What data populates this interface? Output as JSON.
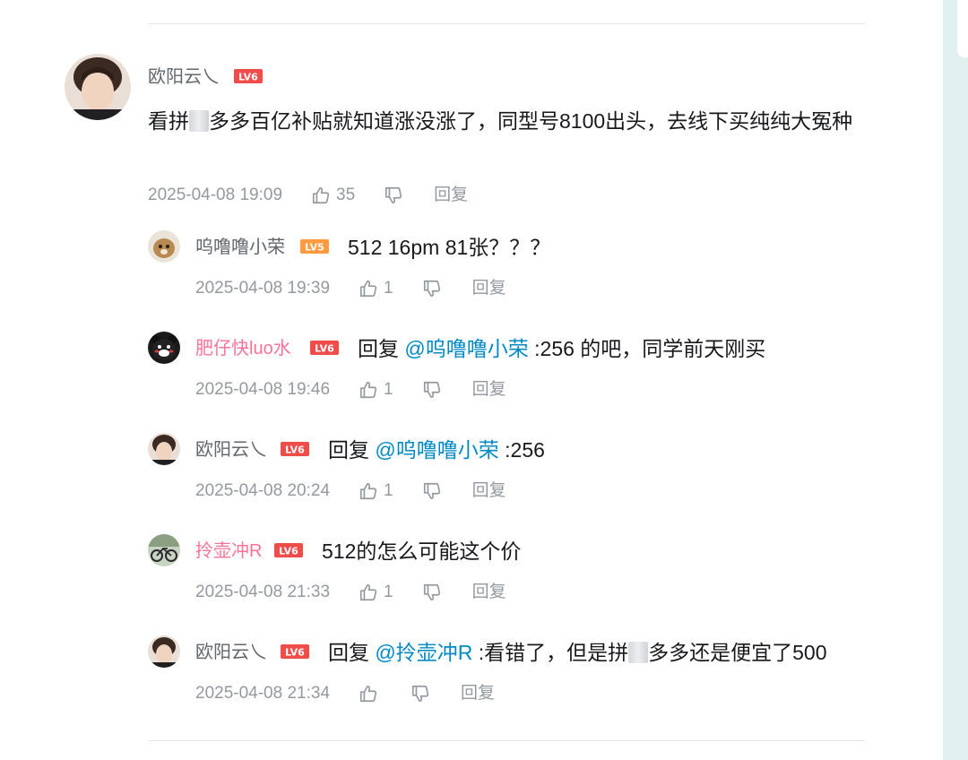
{
  "main_comment": {
    "username": "欧阳云乀",
    "level": "LV6",
    "text_before": "看拼",
    "text_after": "多多百亿补贴就知道涨没涨了，同型号8100出头，去线下买纯纯大冤种",
    "time": "2025-04-08 19:09",
    "likes": "35",
    "reply_label": "回复"
  },
  "replies": [
    {
      "username": "呜噜噜小荣",
      "name_color": "gray",
      "level": "LV5",
      "prefix": "",
      "at": "",
      "text": "512 16pm 81张？？？",
      "time": "2025-04-08 19:39",
      "likes": "1",
      "reply_label": "回复"
    },
    {
      "username": "肥仔快luo水",
      "name_color": "pink",
      "level": "LV6",
      "prefix": "回复 ",
      "at": "@呜噜噜小荣",
      "text": " :256 的吧，同学前天刚买",
      "time": "2025-04-08 19:46",
      "likes": "1",
      "reply_label": "回复"
    },
    {
      "username": "欧阳云乀",
      "name_color": "gray",
      "level": "LV6",
      "prefix": "回复 ",
      "at": "@呜噜噜小荣",
      "text": " :256",
      "time": "2025-04-08 20:24",
      "likes": "1",
      "reply_label": "回复"
    },
    {
      "username": "拎壶冲R",
      "name_color": "pink",
      "level": "LV6",
      "prefix": "",
      "at": "",
      "text": "512的怎么可能这个价",
      "time": "2025-04-08 21:33",
      "likes": "1",
      "reply_label": "回复"
    },
    {
      "username": "欧阳云乀",
      "name_color": "gray",
      "level": "LV6",
      "prefix": "回复 ",
      "at": "@拎壶冲R",
      "text_before": " :看错了，但是拼",
      "text_after": "多多还是便宜了500",
      "time": "2025-04-08 21:34",
      "likes": "",
      "reply_label": "回复"
    }
  ],
  "colors": {
    "level_badge": "#f04c49",
    "pink_name": "#fb7299",
    "mention": "#008ac5",
    "meta": "#9499a0"
  },
  "icons": [
    "like-icon",
    "dislike-icon"
  ]
}
